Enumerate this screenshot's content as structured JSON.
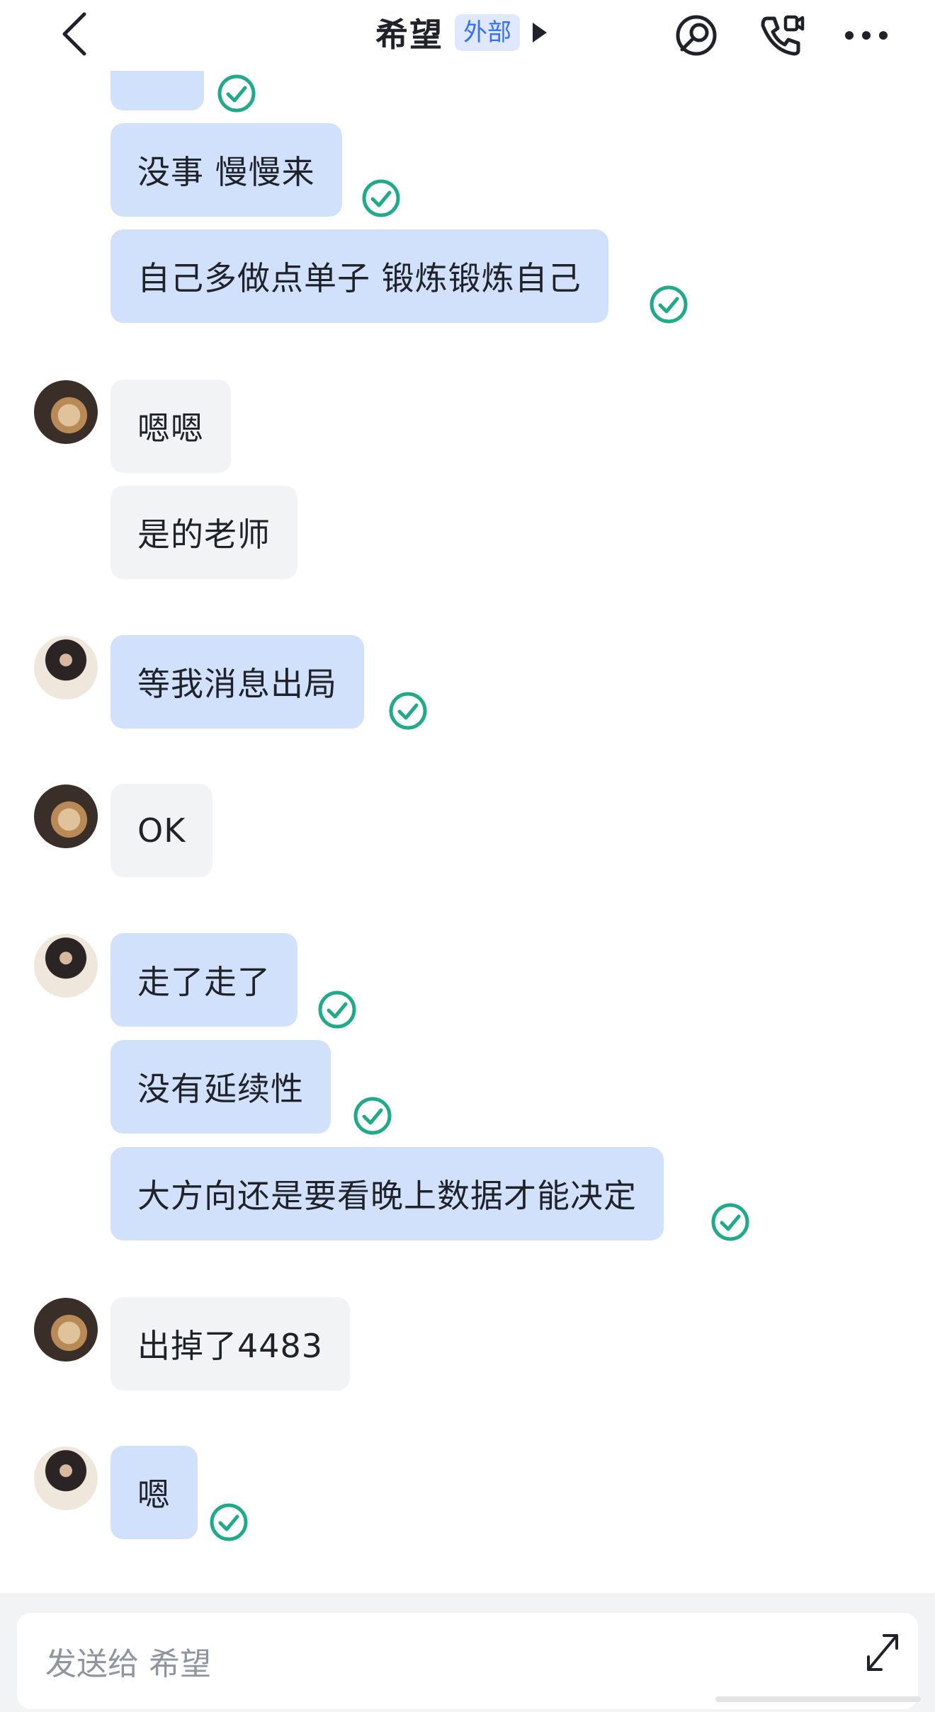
{
  "header": {
    "title": "希望",
    "badge": "外部",
    "back_icon": "chevron-left-icon",
    "chat_icon": "chat-search-icon",
    "call_icon": "video-call-icon",
    "more_icon": "more-dots-icon"
  },
  "colors": {
    "self_bubble": "#d1e1fc",
    "other_bubble": "#f2f3f5",
    "read_check": "#1faa89",
    "badge_bg": "#dfe8fd",
    "badge_text": "#3370ff"
  },
  "messages": [
    {
      "sender": "self",
      "text": "没事 慢慢来",
      "status": "read"
    },
    {
      "sender": "self",
      "text": "自己多做点单子 锻炼锻炼自己",
      "status": "read"
    },
    {
      "sender": "other",
      "text": "嗯嗯"
    },
    {
      "sender": "other",
      "text": "是的老师"
    },
    {
      "sender": "self",
      "text": "等我消息出局",
      "status": "read"
    },
    {
      "sender": "other",
      "text": "OK"
    },
    {
      "sender": "self",
      "text": "走了走了",
      "status": "read"
    },
    {
      "sender": "self",
      "text": "没有延续性",
      "status": "read"
    },
    {
      "sender": "self",
      "text": "大方向还是要看晚上数据才能决定",
      "status": "read"
    },
    {
      "sender": "other",
      "text": "出掉了4483"
    },
    {
      "sender": "self",
      "text": "嗯",
      "status": "read"
    }
  ],
  "composer": {
    "placeholder": "发送给 希望",
    "expand_icon": "expand-icon"
  }
}
